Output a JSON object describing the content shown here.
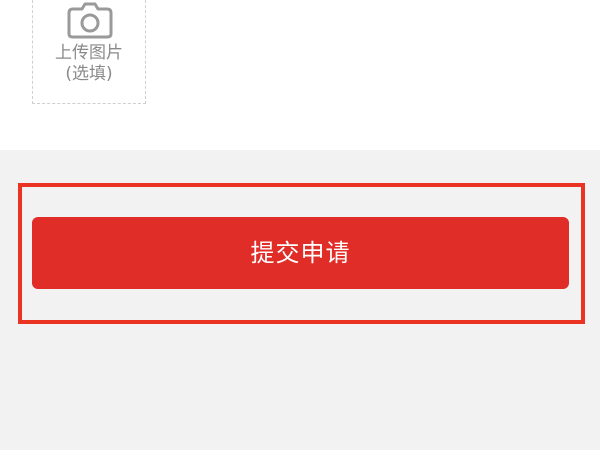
{
  "upload": {
    "title": "上传图片",
    "note": "(选填)",
    "icon": "camera-icon"
  },
  "submit": {
    "label": "提交申请"
  },
  "colors": {
    "button": "#e12d27",
    "highlight": "#ea3323",
    "upload_border": "#cfcfcf",
    "upload_text": "#8a8a8a",
    "page_background": "#f2f2f2"
  }
}
